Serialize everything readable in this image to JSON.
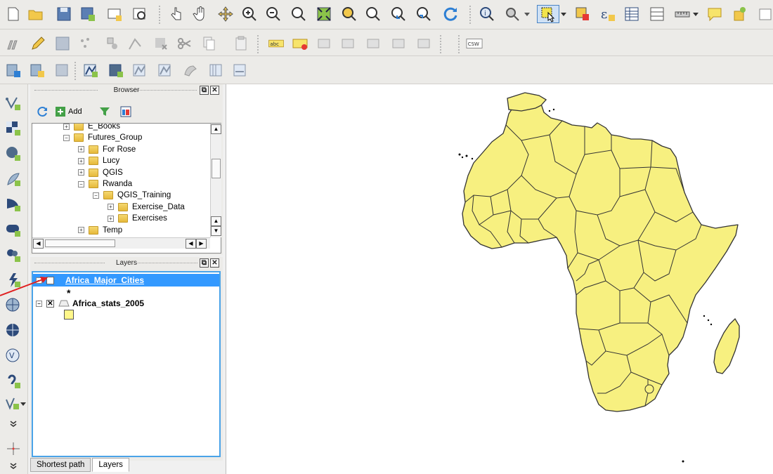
{
  "browser_panel": {
    "title": "Browser",
    "add_label": "Add",
    "tree": [
      {
        "label": "E_Books",
        "depth": 2,
        "expanded": false
      },
      {
        "label": "Futures_Group",
        "depth": 2,
        "expanded": true
      },
      {
        "label": "For Rose",
        "depth": 3,
        "expanded": false
      },
      {
        "label": "Lucy",
        "depth": 3,
        "expanded": false
      },
      {
        "label": "QGIS",
        "depth": 3,
        "expanded": false
      },
      {
        "label": "Rwanda",
        "depth": 3,
        "expanded": true
      },
      {
        "label": "QGIS_Training",
        "depth": 4,
        "expanded": true
      },
      {
        "label": "Exercise_Data",
        "depth": 5,
        "expanded": false
      },
      {
        "label": "Exercises",
        "depth": 5,
        "expanded": false
      },
      {
        "label": "Temp",
        "depth": 3,
        "expanded": false
      }
    ]
  },
  "layers_panel": {
    "title": "Layers",
    "layers": [
      {
        "name": "Africa_Major_Cities",
        "checked": false,
        "selected": true,
        "symbol": "*"
      },
      {
        "name": "Africa_stats_2005",
        "checked": true,
        "selected": false,
        "symbol_color": "#fff78a"
      }
    ]
  },
  "bottom_tabs": [
    {
      "label": "Shortest path",
      "active": false
    },
    {
      "label": "Layers",
      "active": true
    }
  ],
  "toolbar_labels": {
    "csw": "CSW",
    "abc": "abc",
    "epsilon": "ε"
  },
  "map": {
    "fill_color": "#f7f080",
    "stroke_color": "#333333",
    "background": "#ffffff"
  },
  "colors": {
    "selection": "#3399ff",
    "panel_border": "#4aa3e8",
    "arrow": "#e02020"
  }
}
